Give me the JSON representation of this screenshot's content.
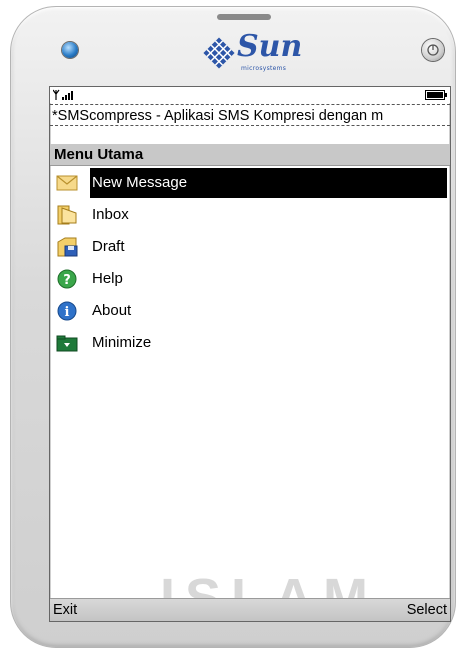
{
  "device": {
    "logo_text": "Sun",
    "logo_subtext": "microsystems",
    "brand_color": "#2d56a8"
  },
  "status": {
    "signal_icon": "signal-strength-icon",
    "battery_icon": "battery-icon"
  },
  "ticker_text": "*SMScompress - Aplikasi SMS Kompresi dengan m",
  "screen_title": "Menu Utama",
  "menu": {
    "items": [
      {
        "label": "New Message",
        "icon": "envelope-icon",
        "selected": true
      },
      {
        "label": "Inbox",
        "icon": "inbox-folder-icon",
        "selected": false
      },
      {
        "label": "Draft",
        "icon": "draft-floppy-icon",
        "selected": false
      },
      {
        "label": "Help",
        "icon": "help-icon",
        "selected": false
      },
      {
        "label": "About",
        "icon": "info-icon",
        "selected": false
      },
      {
        "label": "Minimize",
        "icon": "minimize-icon",
        "selected": false
      }
    ]
  },
  "watermark_text": "ISLAM",
  "softkeys": {
    "left": "Exit",
    "right": "Select"
  }
}
